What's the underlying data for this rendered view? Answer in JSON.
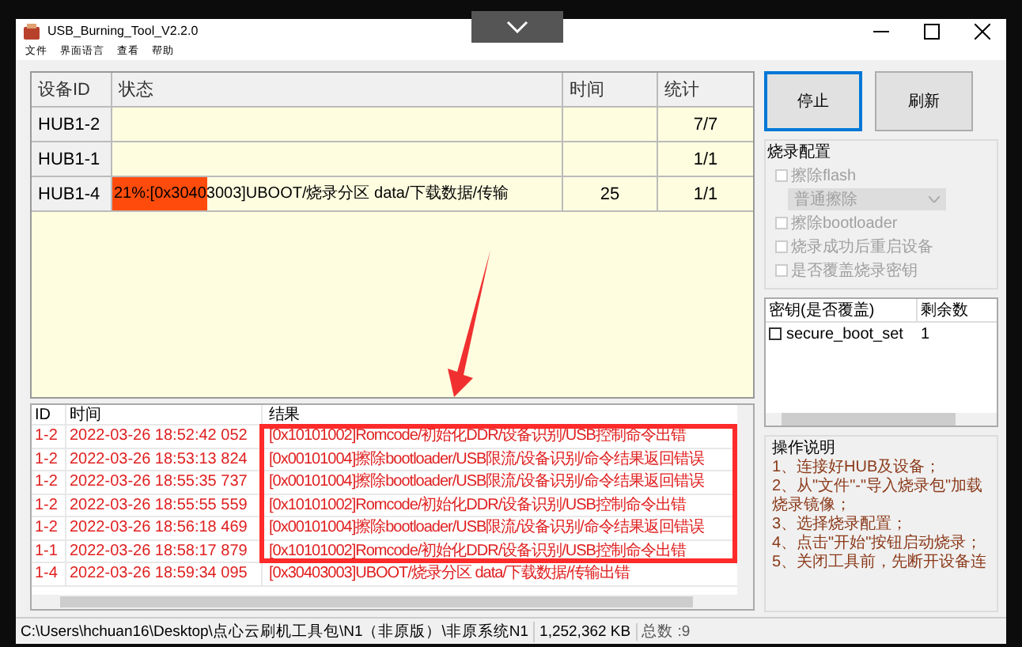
{
  "window": {
    "title": "USB_Burning_Tool_V2.2.0"
  },
  "menu": [
    "文件",
    "界面语言",
    "查看",
    "帮助"
  ],
  "device_table": {
    "columns": [
      "设备ID",
      "状态",
      "时间",
      "统计"
    ],
    "rows": [
      {
        "id": "HUB1-2",
        "count": "7/7"
      },
      {
        "id": "HUB1-1",
        "count": "1/1"
      },
      {
        "id": "HUB1-4",
        "status": "21%:[0x30403003]UBOOT/烧录分区 data/下载数据/传输",
        "time": "25",
        "count": "1/1",
        "level": 0.21
      }
    ]
  },
  "buttons": [
    {
      "label": "停止",
      "selected": true
    },
    {
      "label": "刷新",
      "selected": false
    }
  ],
  "burn_config": {
    "title": "烧录配置",
    "options": [
      {
        "kind": "checkbox",
        "label": "擦除flash",
        "checked": false
      },
      {
        "kind": "dropdown",
        "label": "普通擦除"
      },
      {
        "kind": "checkbox",
        "label": "擦除bootloader",
        "checked": false
      },
      {
        "kind": "checkbox",
        "label": "烧录成功后重启设备",
        "checked": false
      },
      {
        "kind": "checkbox",
        "label": "是否覆盖烧录密钥",
        "checked": false
      }
    ]
  },
  "keys": {
    "columns": [
      "密钥(是否覆盖)",
      "剩余数"
    ],
    "rows": [
      {
        "name": "secure_boot_set",
        "checked": false,
        "remaining": "1"
      }
    ]
  },
  "instructions": {
    "title": "操作说明",
    "lines": [
      "1、连接好HUB及设备；",
      "2、从\"文件\"-\"导入烧录包\"加载烧录镜像；",
      "3、选择烧录配置；",
      "4、点击\"开始\"按钮启动烧录；",
      "5、关闭工具前，先断开设备连"
    ]
  },
  "log": {
    "columns": [
      "ID",
      "时间",
      "结果"
    ],
    "rows": [
      {
        "id": "1-2",
        "time": "2022-03-26 18:52:42 052",
        "result": "[0x10101002]Romcode/初始化DDR/设备识别/USB控制命令出错"
      },
      {
        "id": "1-2",
        "time": "2022-03-26 18:53:13 824",
        "result": "[0x00101004]擦除bootloader/USB限流/设备识别/命令结果返回错误"
      },
      {
        "id": "1-2",
        "time": "2022-03-26 18:55:35 737",
        "result": "[0x00101004]擦除bootloader/USB限流/设备识别/命令结果返回错误"
      },
      {
        "id": "1-2",
        "time": "2022-03-26 18:55:55 559",
        "result": "[0x10101002]Romcode/初始化DDR/设备识别/USB控制命令出错"
      },
      {
        "id": "1-2",
        "time": "2022-03-26 18:56:18 469",
        "result": "[0x00101004]擦除bootloader/USB限流/设备识别/命令结果返回错误"
      },
      {
        "id": "1-1",
        "time": "2022-03-26 18:58:17 879",
        "result": "[0x10101002]Romcode/初始化DDR/设备识别/USB控制命令出错"
      },
      {
        "id": "1-4",
        "time": "2022-03-26 18:59:34 095",
        "result": "[0x30403003]UBOOT/烧录分区 data/下载数据/传输出错"
      }
    ]
  },
  "status_bar": {
    "path": "C:\\Users\\hchuan16\\Desktop\\点心云刷机工具包\\N1（非原版）\\非原系统N1",
    "size": "1,252,362 KB",
    "total": "总数 :9"
  }
}
